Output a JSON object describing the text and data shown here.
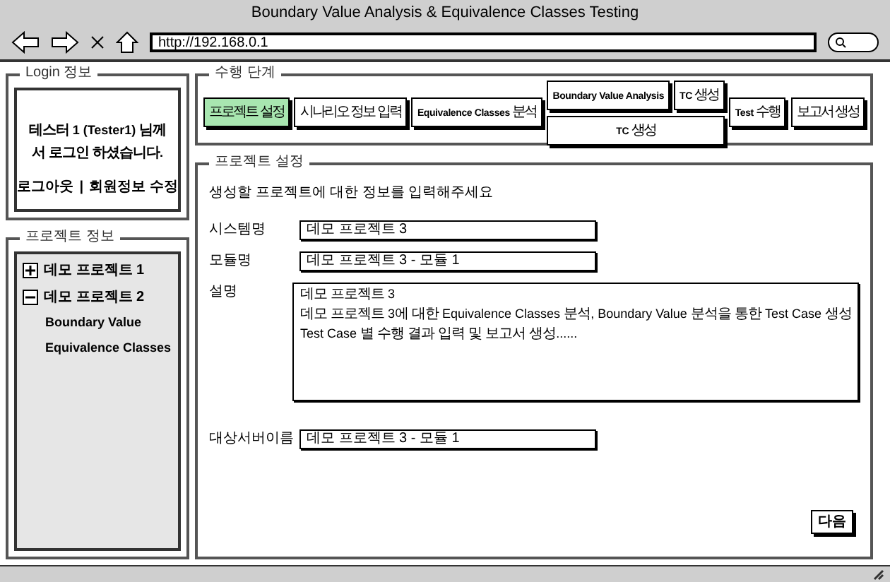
{
  "window": {
    "title": "Boundary Value Analysis & Equivalence Classes Testing"
  },
  "address_bar": {
    "value": "http://192.168.0.1"
  },
  "login": {
    "title": "Login 정보",
    "message": "테스터 1 (Tester1) 님께서 로그인 하셨습니다.",
    "logout_link": "로그아웃",
    "separator": "|",
    "profile_link": "회원정보 수정"
  },
  "project_info": {
    "title": "프로젝트 정보",
    "tree": [
      {
        "label": "데모 프로젝트 1",
        "expanded": false
      },
      {
        "label": "데모 프로젝트 2",
        "expanded": true,
        "children": [
          {
            "label": "Boundary Value"
          },
          {
            "label": "Equivalence Classes"
          }
        ]
      }
    ]
  },
  "steps": {
    "title": "수행 단계",
    "items": [
      {
        "kind": "single",
        "label": "프로젝트 설정",
        "selected": true
      },
      {
        "kind": "single",
        "label": "시나리오 정보 입력",
        "selected": false
      },
      {
        "kind": "single",
        "label": "Equivalence Classes 분석",
        "selected": false
      },
      {
        "kind": "branch",
        "top": [
          {
            "label": "Boundary Value Analysis",
            "selected": false
          },
          {
            "label": "TC 생성",
            "selected": false
          }
        ],
        "bottom": {
          "label": "TC 생성",
          "selected": false
        }
      },
      {
        "kind": "single",
        "label": "Test 수행",
        "selected": false
      },
      {
        "kind": "single",
        "label": "보고서 생성",
        "selected": false
      }
    ]
  },
  "project_settings": {
    "title": "프로젝트 설정",
    "instruction": "생성할 프로젝트에 대한 정보를 입력해주세요",
    "fields": [
      {
        "kind": "text",
        "label": "시스템명",
        "value": "데모 프로젝트 3"
      },
      {
        "kind": "text",
        "label": "모듈명",
        "value": "데모 프로젝트 3 - 모듈 1"
      },
      {
        "kind": "textarea",
        "label": "설명",
        "lines": [
          "데모 프로젝트 3",
          "데모 프로젝트 3에 대한 Equivalence Classes 분석, Boundary Value 분석을 통한 Test Case 생성",
          "Test Case 별 수행 결과 입력 및 보고서 생성......"
        ]
      },
      {
        "kind": "text",
        "label": "대상서버이름",
        "value": "데모 프로젝트 3 - 모듈 1"
      }
    ],
    "next_button": "다음"
  }
}
